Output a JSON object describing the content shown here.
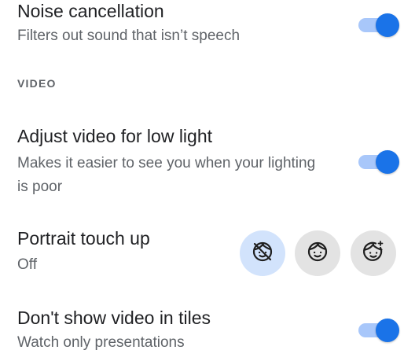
{
  "settings": {
    "noise_cancellation": {
      "title": "Noise cancellation",
      "subtitle": "Filters out sound that isn’t speech",
      "enabled": true
    },
    "video_section_header": "VIDEO",
    "low_light": {
      "title": "Adjust video for low light",
      "subtitle": "Makes it easier to see you when your lighting is poor",
      "enabled": true
    },
    "portrait_touch_up": {
      "title": "Portrait touch up",
      "subtitle": "Off",
      "options": [
        {
          "icon": "face-off-icon",
          "selected": true
        },
        {
          "icon": "face-icon",
          "selected": false
        },
        {
          "icon": "face-retouch-icon",
          "selected": false
        }
      ]
    },
    "hide_video_tiles": {
      "title": "Don't show video in tiles",
      "subtitle": "Watch only presentations",
      "enabled": true
    }
  },
  "colors": {
    "accent": "#1a73e8",
    "track_on": "#a8c7fa",
    "selected_option_bg": "#d2e3fc",
    "option_bg": "#e3e3e3"
  }
}
